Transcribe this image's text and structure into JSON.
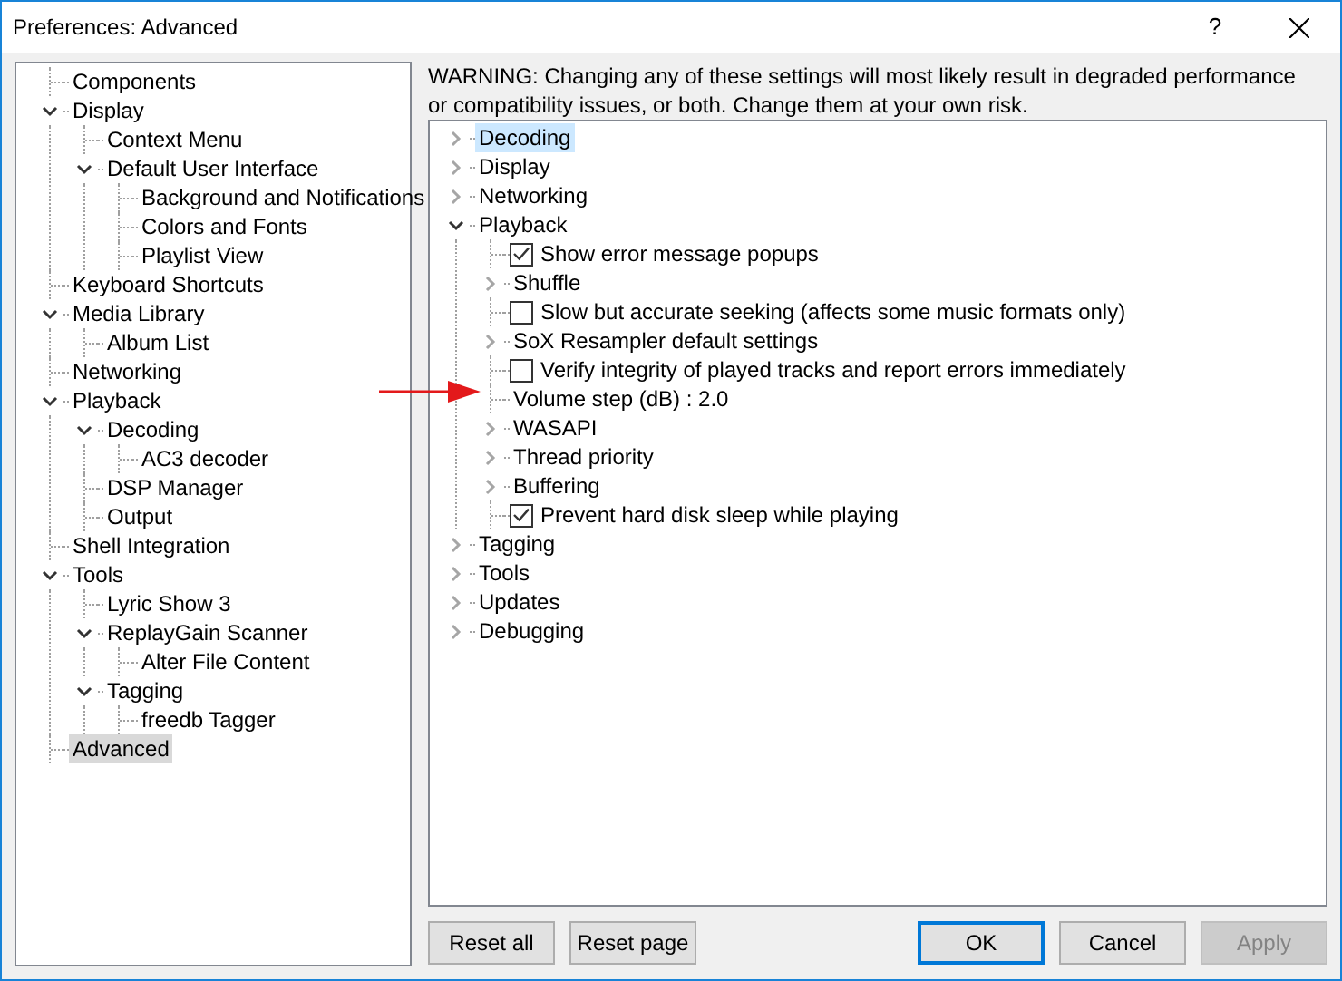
{
  "window": {
    "title": "Preferences: Advanced",
    "help": "?"
  },
  "page_tree": [
    {
      "label": "Components",
      "selected": false
    },
    {
      "label": "Display",
      "selected": false,
      "expanded": true,
      "children": [
        {
          "label": "Context Menu",
          "selected": false
        },
        {
          "label": "Default User Interface",
          "selected": false,
          "expanded": true,
          "children": [
            {
              "label": "Background and Notifications",
              "selected": false
            },
            {
              "label": "Colors and Fonts",
              "selected": false
            },
            {
              "label": "Playlist View",
              "selected": false
            }
          ]
        }
      ]
    },
    {
      "label": "Keyboard Shortcuts",
      "selected": false
    },
    {
      "label": "Media Library",
      "selected": false,
      "expanded": true,
      "children": [
        {
          "label": "Album List",
          "selected": false
        }
      ]
    },
    {
      "label": "Networking",
      "selected": false
    },
    {
      "label": "Playback",
      "selected": false,
      "expanded": true,
      "children": [
        {
          "label": "Decoding",
          "selected": false,
          "expanded": true,
          "children": [
            {
              "label": "AC3 decoder",
              "selected": false
            }
          ]
        },
        {
          "label": "DSP Manager",
          "selected": false
        },
        {
          "label": "Output",
          "selected": false
        }
      ]
    },
    {
      "label": "Shell Integration",
      "selected": false
    },
    {
      "label": "Tools",
      "selected": false,
      "expanded": true,
      "children": [
        {
          "label": "Lyric Show 3",
          "selected": false
        },
        {
          "label": "ReplayGain Scanner",
          "selected": false,
          "expanded": true,
          "children": [
            {
              "label": "Alter File Content",
              "selected": false
            }
          ]
        },
        {
          "label": "Tagging",
          "selected": false,
          "expanded": true,
          "children": [
            {
              "label": "freedb Tagger",
              "selected": false
            }
          ]
        }
      ]
    },
    {
      "label": "Advanced",
      "selected": true
    }
  ],
  "warning": "WARNING: Changing any of these settings will most likely result in degraded performance or compatibility issues, or both. Change them at your own risk.",
  "settings_tree": [
    {
      "kind": "branch",
      "label": "Decoding",
      "selected": true,
      "expanded": false
    },
    {
      "kind": "branch",
      "label": "Display",
      "selected": false,
      "expanded": false
    },
    {
      "kind": "branch",
      "label": "Networking",
      "selected": false,
      "expanded": false
    },
    {
      "kind": "branch",
      "label": "Playback",
      "selected": false,
      "expanded": true,
      "children": [
        {
          "kind": "checkbox",
          "label": "Show error message popups",
          "selected": false,
          "checked": true
        },
        {
          "kind": "branch",
          "label": "Shuffle",
          "selected": false,
          "expanded": false
        },
        {
          "kind": "checkbox",
          "label": "Slow but accurate seeking (affects some music formats only)",
          "selected": false,
          "checked": false
        },
        {
          "kind": "branch",
          "label": "SoX Resampler default settings",
          "selected": false,
          "expanded": false
        },
        {
          "kind": "checkbox",
          "label": "Verify integrity of played tracks and report errors immediately",
          "selected": false,
          "checked": false
        },
        {
          "kind": "value",
          "label": "Volume step (dB) : 2.0",
          "selected": false
        },
        {
          "kind": "branch",
          "label": "WASAPI",
          "selected": false,
          "expanded": false
        },
        {
          "kind": "branch",
          "label": "Thread priority",
          "selected": false,
          "expanded": false
        },
        {
          "kind": "branch",
          "label": "Buffering",
          "selected": false,
          "expanded": false
        },
        {
          "kind": "checkbox",
          "label": "Prevent hard disk sleep while playing",
          "selected": false,
          "checked": true
        }
      ]
    },
    {
      "kind": "branch",
      "label": "Tagging",
      "selected": false,
      "expanded": false
    },
    {
      "kind": "branch",
      "label": "Tools",
      "selected": false,
      "expanded": false
    },
    {
      "kind": "branch",
      "label": "Updates",
      "selected": false,
      "expanded": false
    },
    {
      "kind": "branch",
      "label": "Debugging",
      "selected": false,
      "expanded": false
    }
  ],
  "buttons": [
    {
      "label": "Reset all",
      "kind": "normal"
    },
    {
      "label": "Reset page",
      "kind": "normal"
    },
    {
      "label": "OK",
      "kind": "default"
    },
    {
      "label": "Cancel",
      "kind": "normal"
    },
    {
      "label": "Apply",
      "kind": "disabled"
    }
  ]
}
